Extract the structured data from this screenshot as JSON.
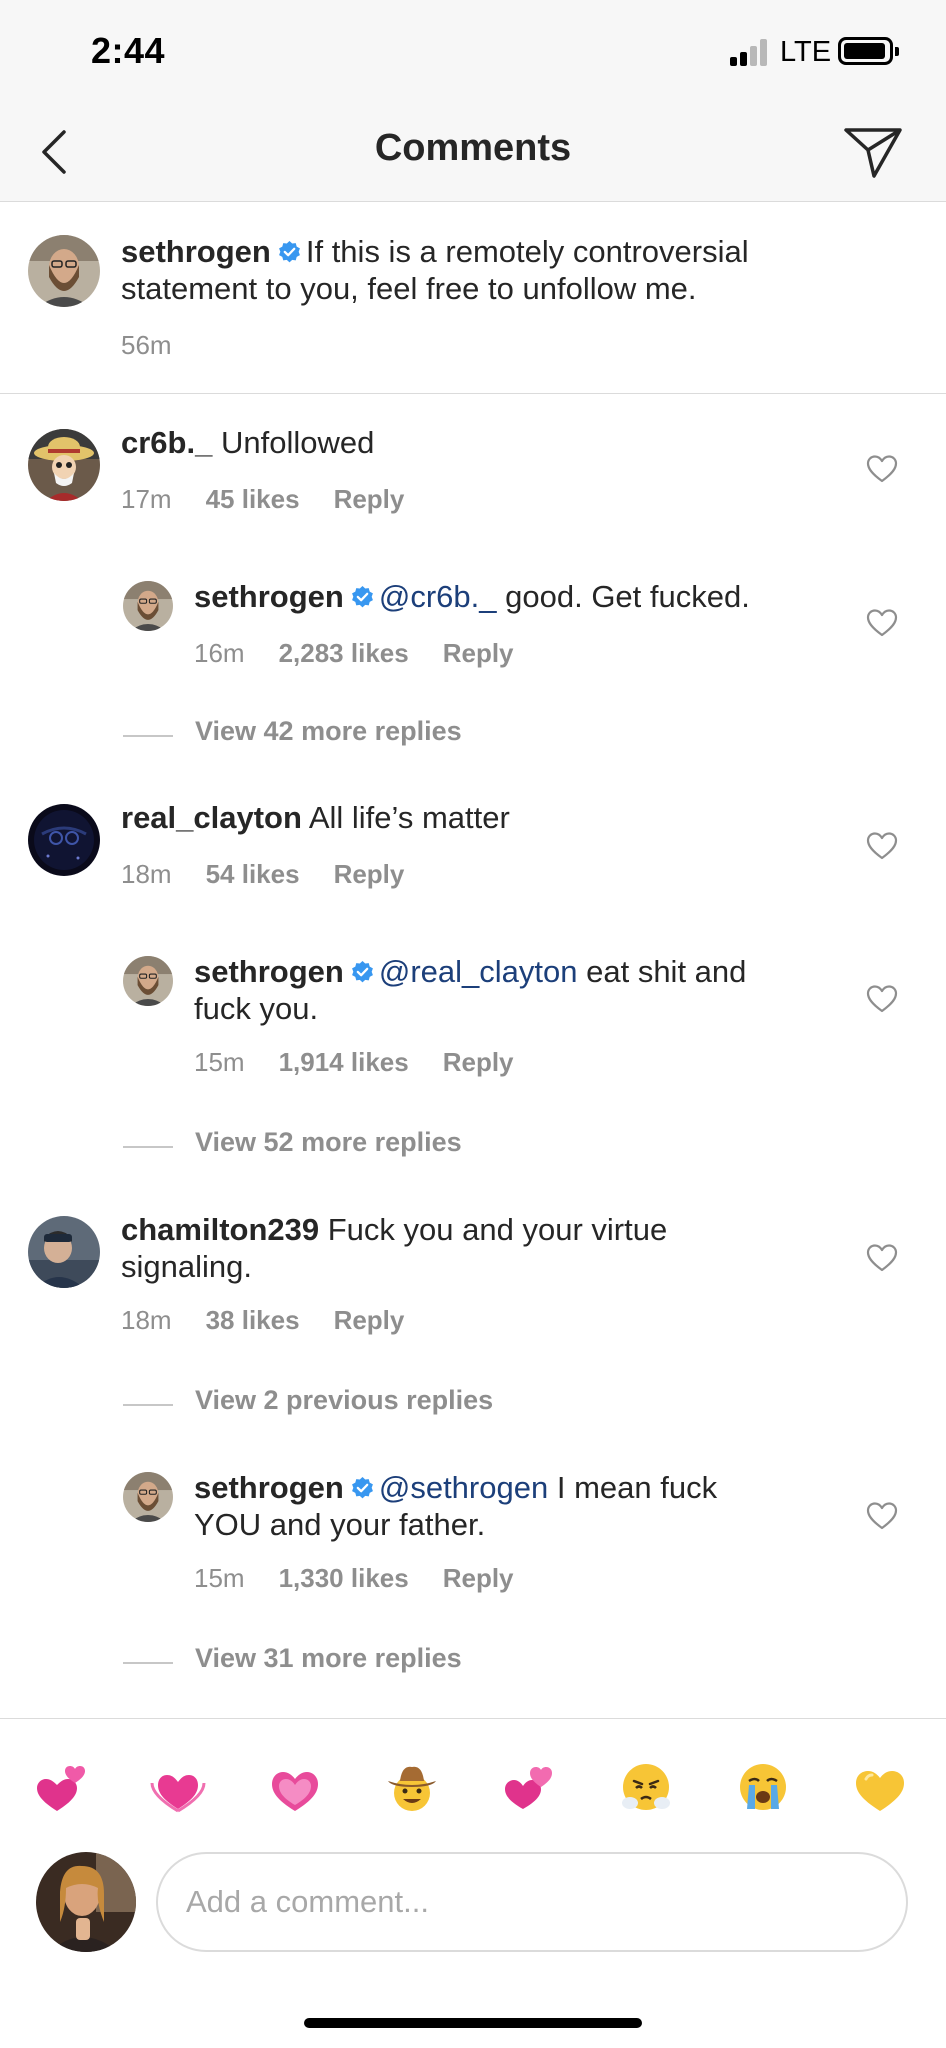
{
  "status_bar": {
    "time": "2:44",
    "network": "LTE"
  },
  "header": {
    "title": "Comments"
  },
  "caption": {
    "username": "sethrogen",
    "verified": true,
    "text_line1": "If this is a remotely controversial",
    "text_line2": "statement to you, feel free to unfollow me.",
    "time": "56m"
  },
  "comments": [
    {
      "username": "cr6b._",
      "text": "Unfollowed",
      "time": "17m",
      "likes": "45 likes",
      "reply_label": "Reply",
      "reply": {
        "username": "sethrogen",
        "mention": "@cr6b._",
        "text_line1": "good. Get fucked.",
        "time": "16m",
        "likes": "2,283 likes",
        "reply_label": "Reply"
      },
      "view_more": "View 42 more replies"
    },
    {
      "username": "real_clayton",
      "text": "All life’s matter",
      "time": "18m",
      "likes": "54 likes",
      "reply_label": "Reply",
      "reply": {
        "username": "sethrogen",
        "mention": "@real_clayton",
        "text_line1": "eat shit and",
        "text_line2": "fuck you.",
        "time": "15m",
        "likes": "1,914 likes",
        "reply_label": "Reply"
      },
      "view_more": "View 52 more replies"
    },
    {
      "username": "chamilton239",
      "text_line1": "Fuck you and your virtue",
      "text_line2": "signaling.",
      "time": "18m",
      "likes": "38 likes",
      "reply_label": "Reply",
      "view_previous": "View 2 previous replies",
      "reply": {
        "username": "sethrogen",
        "mention": "@sethrogen",
        "text_line1": "I mean fuck",
        "text_line2": "YOU and your father.",
        "time": "15m",
        "likes": "1,330 likes",
        "reply_label": "Reply"
      },
      "view_more": "View 31 more replies"
    }
  ],
  "emoji_bar": [
    "two-hearts",
    "growing-heart",
    "sparkling-heart",
    "cowboy-face",
    "revolving-hearts",
    "face-with-steam",
    "loudly-crying-face",
    "yellow-heart"
  ],
  "composer": {
    "placeholder": "Add a comment..."
  },
  "colors": {
    "verified_blue": "#3897f0",
    "mention_blue": "#1c3f7a",
    "meta_gray": "#8e8e8e"
  }
}
